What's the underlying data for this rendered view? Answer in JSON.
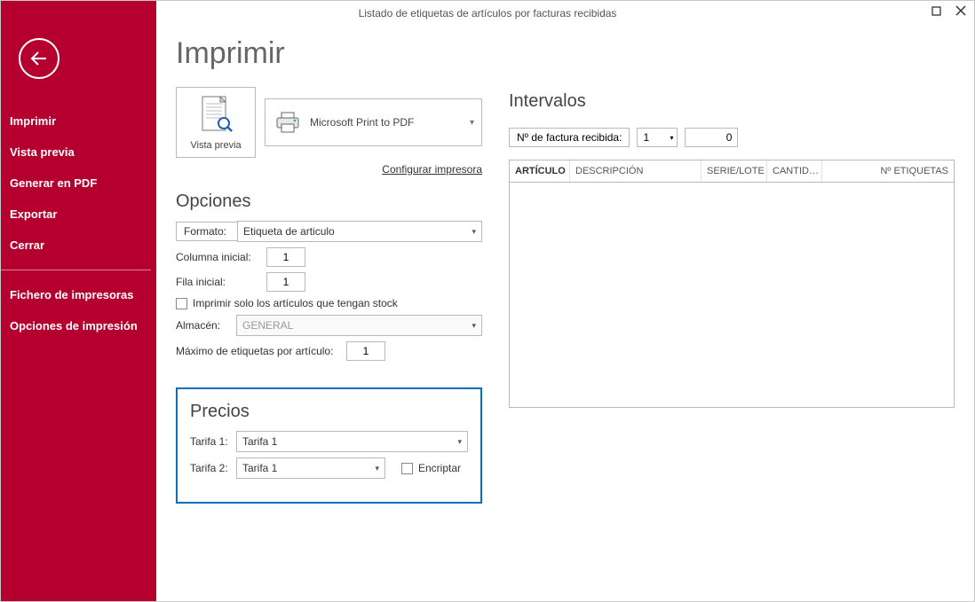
{
  "window": {
    "title": "Listado de etiquetas de artículos por facturas recibidas"
  },
  "sidebar": {
    "items": [
      {
        "label": "Imprimir"
      },
      {
        "label": "Vista previa"
      },
      {
        "label": "Generar en PDF"
      },
      {
        "label": "Exportar"
      },
      {
        "label": "Cerrar"
      }
    ],
    "items2": [
      {
        "label": "Fichero de impresoras"
      },
      {
        "label": "Opciones de impresión"
      }
    ]
  },
  "main": {
    "heading": "Imprimir",
    "vista_previa_label": "Vista previa",
    "printer_selected": "Microsoft Print to PDF",
    "config_link": "Configurar impresora"
  },
  "opciones": {
    "heading": "Opciones",
    "formato_label": "Formato:",
    "formato_value": "Etiqueta de articulo",
    "columna_label": "Columna inicial:",
    "columna_value": "1",
    "fila_label": "Fila inicial:",
    "fila_value": "1",
    "stock_checkbox_label": "Imprimir solo los artículos que tengan stock",
    "almacen_label": "Almacén:",
    "almacen_value": "GENERAL",
    "max_label": "Máximo de etiquetas por artículo:",
    "max_value": "1"
  },
  "precios": {
    "heading": "Precios",
    "tarifa1_label": "Tarifa 1:",
    "tarifa1_value": "Tarifa 1",
    "tarifa2_label": "Tarifa 2:",
    "tarifa2_value": "Tarifa 1",
    "encriptar_label": "Encriptar"
  },
  "intervalos": {
    "heading": "Intervalos",
    "factura_label": "Nº de factura recibida:",
    "factura_from": "1",
    "factura_to": "0",
    "grid_headers": {
      "articulo": "ARTÍCULO",
      "descripcion": "DESCRIPCIÓN",
      "serie": "SERIE/LOTE",
      "cantidad": "CANTID…",
      "etiquetas": "Nº ETIQUETAS"
    }
  }
}
